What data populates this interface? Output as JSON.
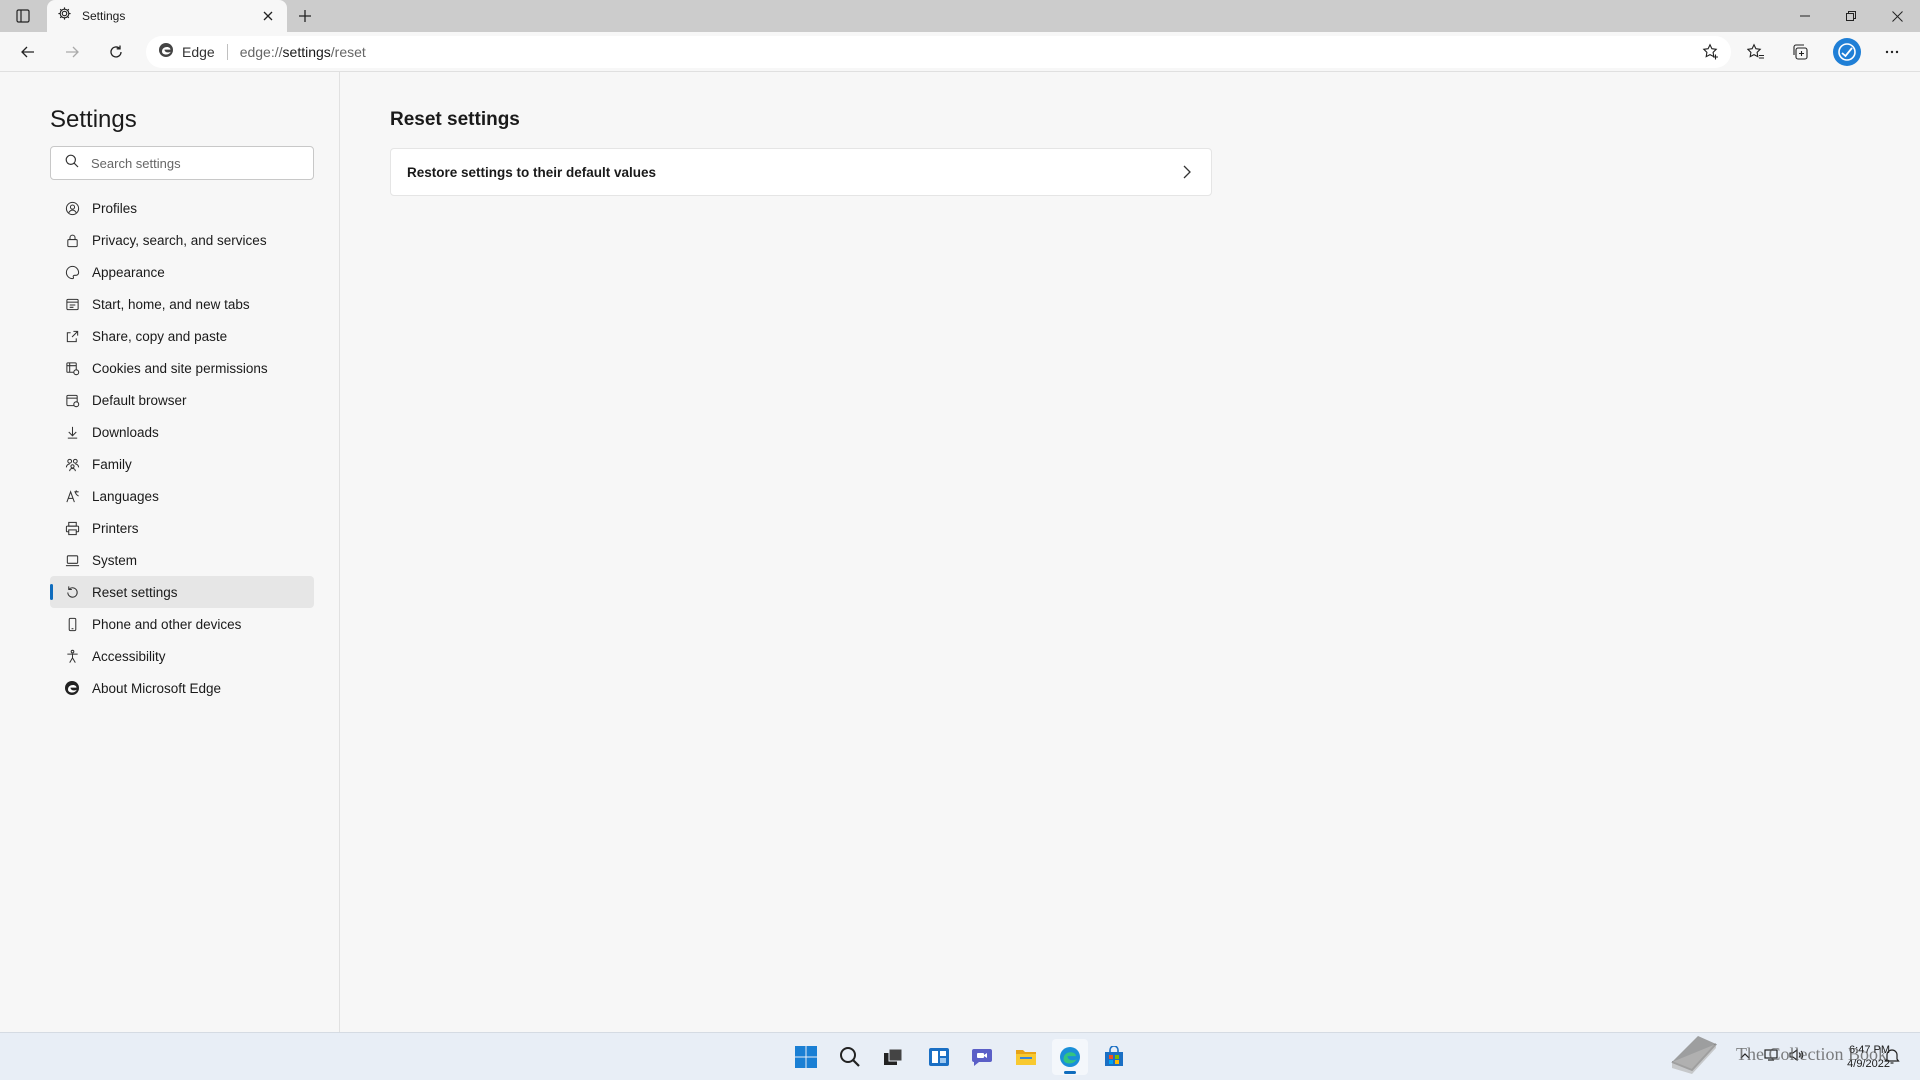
{
  "browser": {
    "tab_title": "Settings",
    "address_site": "Edge",
    "address_url_prefix": "edge://",
    "address_url_host": "settings",
    "address_url_path": "/reset"
  },
  "sidebar": {
    "title": "Settings",
    "search_placeholder": "Search settings",
    "items": [
      {
        "label": "Profiles",
        "icon": "profile-icon"
      },
      {
        "label": "Privacy, search, and services",
        "icon": "lock-icon"
      },
      {
        "label": "Appearance",
        "icon": "palette-icon"
      },
      {
        "label": "Start, home, and new tabs",
        "icon": "home-tabs-icon"
      },
      {
        "label": "Share, copy and paste",
        "icon": "share-icon"
      },
      {
        "label": "Cookies and site permissions",
        "icon": "cookies-icon"
      },
      {
        "label": "Default browser",
        "icon": "browser-icon"
      },
      {
        "label": "Downloads",
        "icon": "download-icon"
      },
      {
        "label": "Family",
        "icon": "family-icon"
      },
      {
        "label": "Languages",
        "icon": "languages-icon"
      },
      {
        "label": "Printers",
        "icon": "printer-icon"
      },
      {
        "label": "System",
        "icon": "system-icon"
      },
      {
        "label": "Reset settings",
        "icon": "reset-icon",
        "active": true
      },
      {
        "label": "Phone and other devices",
        "icon": "phone-icon"
      },
      {
        "label": "Accessibility",
        "icon": "accessibility-icon"
      },
      {
        "label": "About Microsoft Edge",
        "icon": "edge-icon"
      }
    ]
  },
  "main": {
    "title": "Reset settings",
    "card_label": "Restore settings to their default values"
  },
  "taskbar": {
    "time": "6:47 PM",
    "date": "4/9/2022",
    "watermark": "The Collection Book"
  },
  "colors": {
    "accent": "#0f6cbd",
    "background": "#f7f7f7",
    "titlebar": "#cccccc",
    "taskbar": "#e8eef6"
  }
}
